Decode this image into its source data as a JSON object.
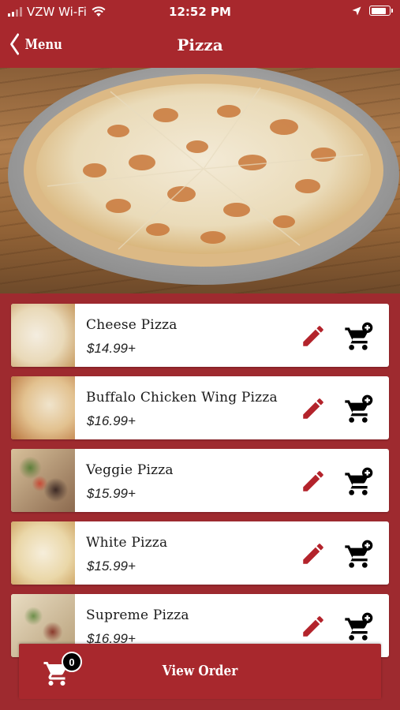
{
  "status_bar": {
    "carrier": "VZW Wi-Fi",
    "time": "12:52 PM",
    "battery_level": 0.85
  },
  "nav": {
    "back_label": "Menu",
    "title": "Pizza"
  },
  "hero": {
    "icon": "pizza-photo"
  },
  "items": [
    {
      "name": "Cheese Pizza",
      "price": "$14.99+",
      "thumb": "cheese"
    },
    {
      "name": "Buffalo Chicken Wing Pizza",
      "price": "$16.99+",
      "thumb": "buffalo"
    },
    {
      "name": "Veggie Pizza",
      "price": "$15.99+",
      "thumb": "veggie"
    },
    {
      "name": "White Pizza",
      "price": "$15.99+",
      "thumb": "white"
    },
    {
      "name": "Supreme Pizza",
      "price": "$16.99+",
      "thumb": "supreme"
    }
  ],
  "order_bar": {
    "badge_count": "0",
    "label": "View Order"
  },
  "colors": {
    "brand_red": "#a8282d",
    "icon_red": "#b3232b",
    "background": "#9e2a2f"
  }
}
